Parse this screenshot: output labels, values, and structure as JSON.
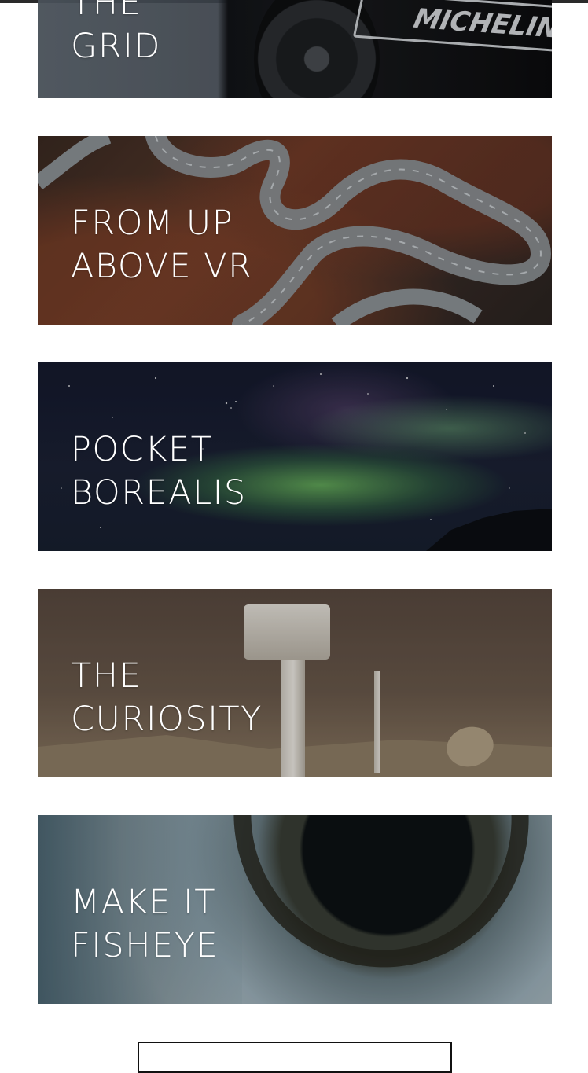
{
  "cards": [
    {
      "id": "the-grid",
      "title_line1": "THE",
      "title_line2": "GRID",
      "badge_text": "MICHELIN"
    },
    {
      "id": "from-up-above-vr",
      "title_line1": "FROM UP",
      "title_line2": "ABOVE VR"
    },
    {
      "id": "pocket-borealis",
      "title_line1": "POCKET",
      "title_line2": "BOREALIS"
    },
    {
      "id": "the-curiosity",
      "title_line1": "THE",
      "title_line2": "CURIOSITY"
    },
    {
      "id": "make-it-fisheye",
      "title_line1": "MAKE IT",
      "title_line2": "FISHEYE"
    }
  ],
  "footer": {
    "more_button_label": ""
  },
  "colors": {
    "title_text": "#ffffff",
    "page_background": "#ffffff",
    "top_bar": "#2a2a2a"
  }
}
